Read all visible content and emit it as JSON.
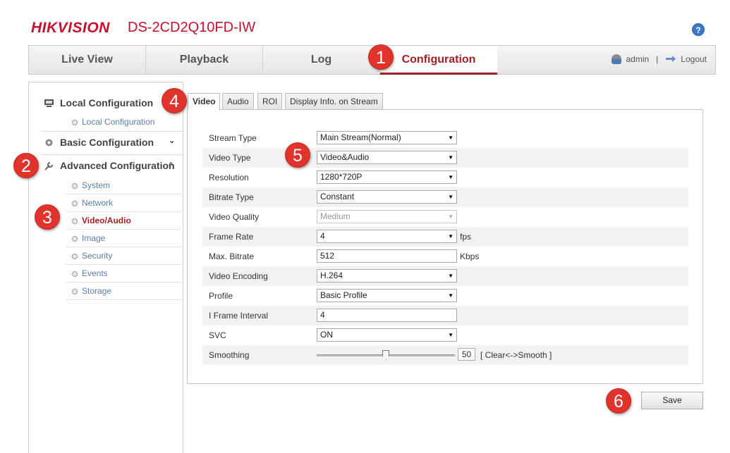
{
  "header": {
    "brand": "HIKVISION",
    "model": "DS-2CD2Q10FD-IW",
    "help_glyph": "?"
  },
  "nav": {
    "tabs": [
      {
        "label": "Live View",
        "active": false
      },
      {
        "label": "Playback",
        "active": false
      },
      {
        "label": "Log",
        "active": false
      },
      {
        "label": "Configuration",
        "active": true
      }
    ],
    "user": "admin",
    "separator": "|",
    "logout": "Logout"
  },
  "sidebar": {
    "local": {
      "label": "Local Configuration",
      "icon": "computer-icon",
      "items": [
        "Local Configuration"
      ]
    },
    "basic": {
      "label": "Basic Configuration",
      "icon": "gear-icon",
      "chevron": "⌄"
    },
    "advanced": {
      "label": "Advanced Configuration",
      "icon": "wrench-icon",
      "chevron": "^",
      "items": [
        "System",
        "Network",
        "Video/Audio",
        "Image",
        "Security",
        "Events",
        "Storage"
      ],
      "active_item": "Video/Audio"
    }
  },
  "tabs": [
    "Video",
    "Audio",
    "ROI",
    "Display Info. on Stream"
  ],
  "active_tab": "Video",
  "form": {
    "stream_type": {
      "label": "Stream Type",
      "value": "Main Stream(Normal)"
    },
    "video_type": {
      "label": "Video Type",
      "value": "Video&Audio"
    },
    "resolution": {
      "label": "Resolution",
      "value": "1280*720P"
    },
    "bitrate_type": {
      "label": "Bitrate Type",
      "value": "Constant"
    },
    "video_quality": {
      "label": "Video Quality",
      "value": "Medium",
      "disabled": true
    },
    "frame_rate": {
      "label": "Frame Rate",
      "value": "4",
      "unit": "fps"
    },
    "max_bitrate": {
      "label": "Max. Bitrate",
      "value": "512",
      "unit": "Kbps"
    },
    "video_encoding": {
      "label": "Video Encoding",
      "value": "H.264"
    },
    "profile": {
      "label": "Profile",
      "value": "Basic Profile"
    },
    "i_frame_interval": {
      "label": "I Frame Interval",
      "value": "4"
    },
    "svc": {
      "label": "SVC",
      "value": "ON"
    },
    "smoothing": {
      "label": "Smoothing",
      "value": "50",
      "level": 0.5,
      "hint": "[ Clear<->Smooth ]"
    }
  },
  "save_label": "Save",
  "markers": [
    "1",
    "2",
    "3",
    "4",
    "5",
    "6"
  ],
  "colors": {
    "accent": "#a41e23",
    "marker": "#e0332b",
    "link": "#5b7fa6"
  }
}
